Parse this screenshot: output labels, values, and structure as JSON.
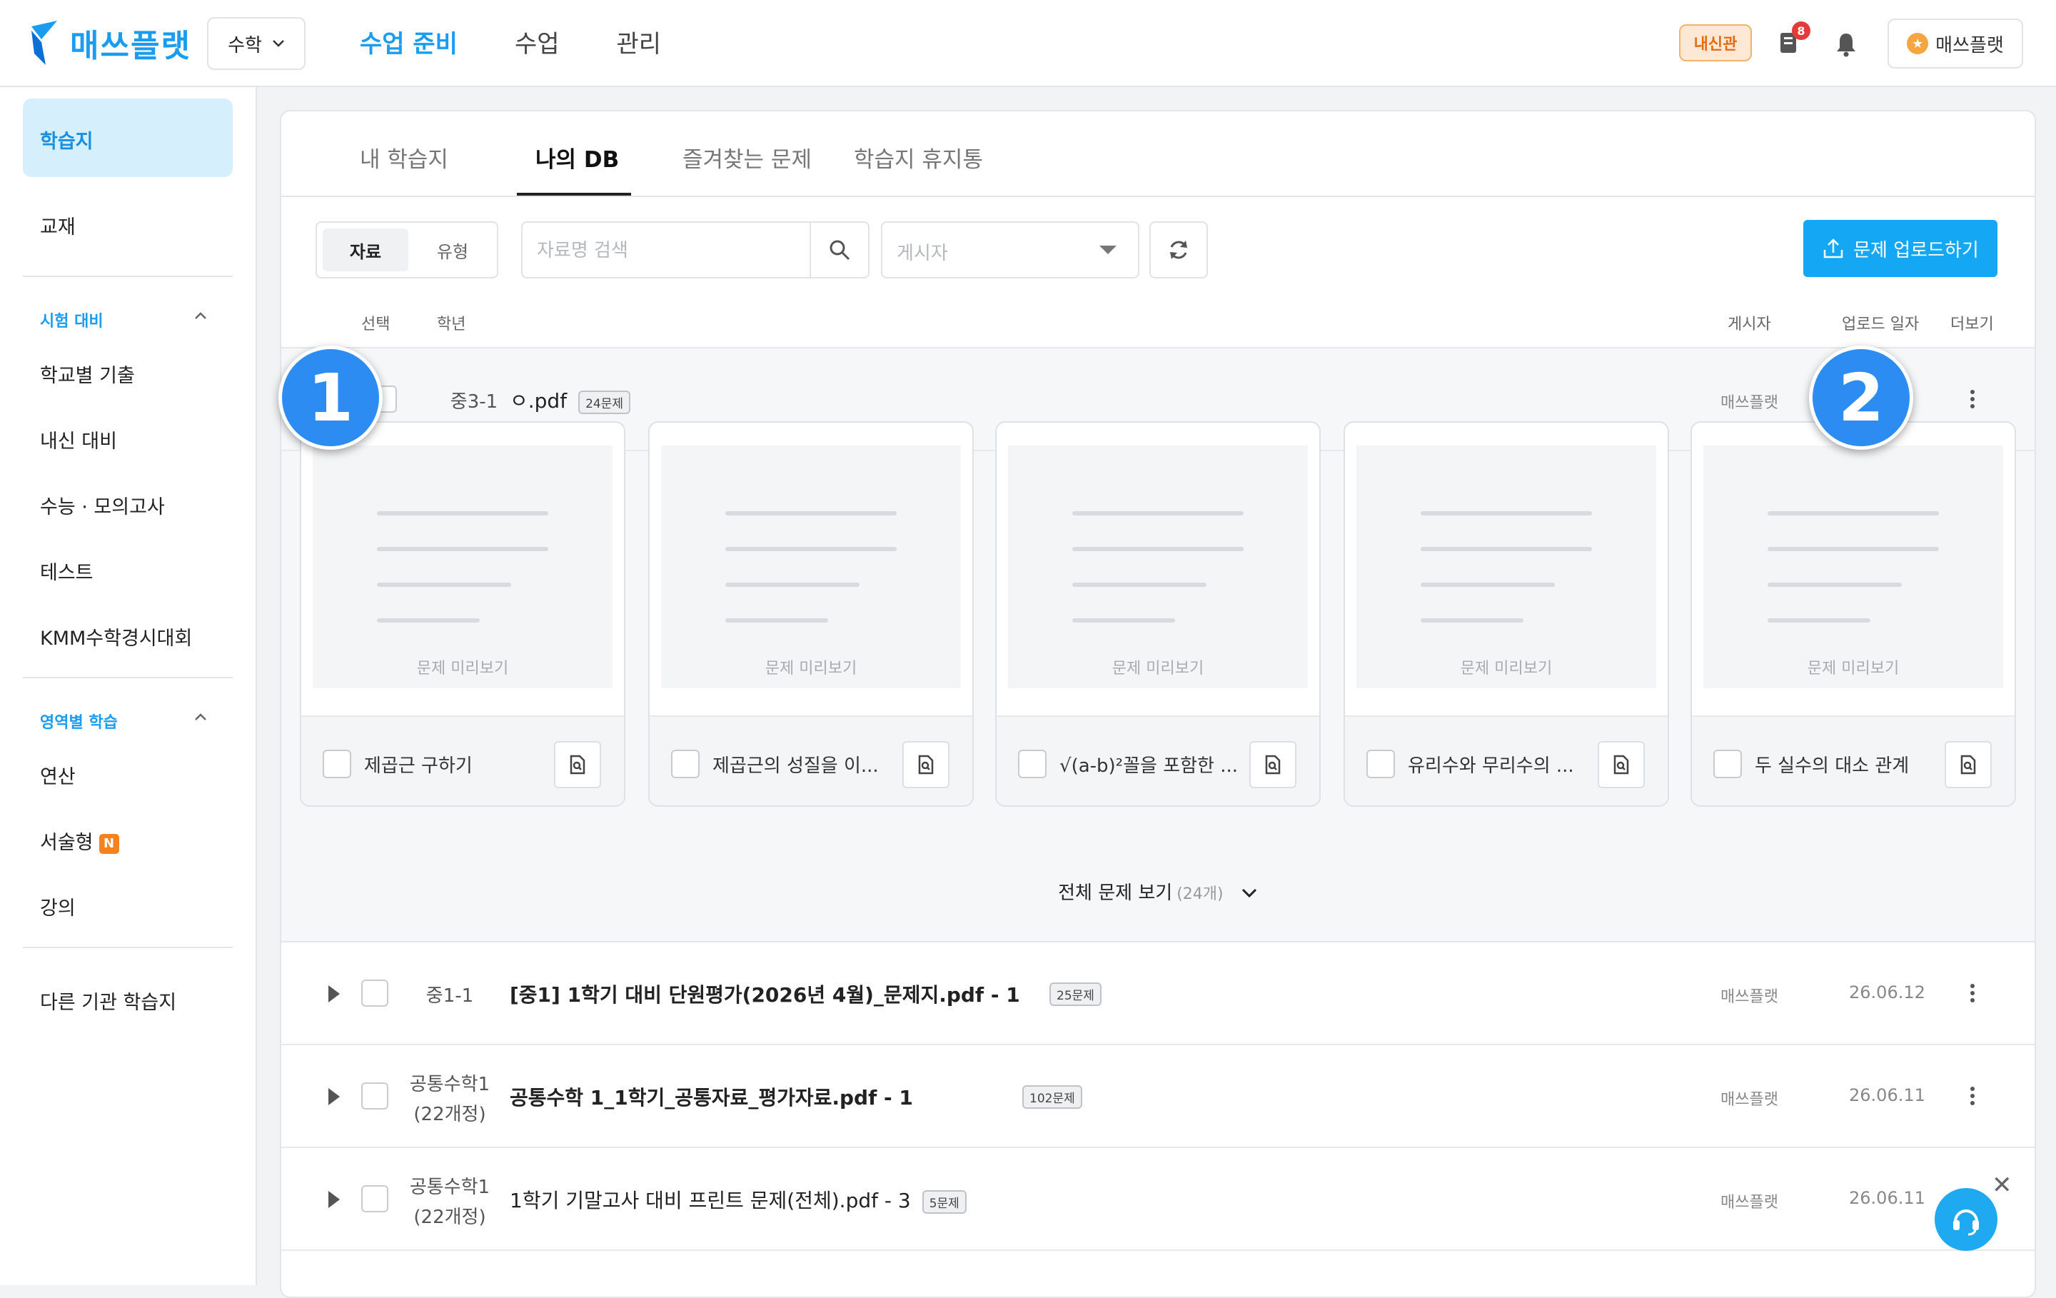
{
  "topbar": {
    "logo_text": "매쓰플랫",
    "subject": "수학",
    "nav": [
      "수업 준비",
      "수업",
      "관리"
    ],
    "naesin_badge": "내신관",
    "notification_count": "8",
    "profile_label": "매쓰플랫"
  },
  "sidebar": {
    "active": "학습지",
    "textbook": "교재",
    "section1": "시험 대비",
    "section1_items": [
      "학교별 기출",
      "내신 대비",
      "수능 · 모의고사",
      "테스트",
      "KMM수학경시대회"
    ],
    "section2": "영역별 학습",
    "section2_items": [
      "연산",
      "서술형",
      "강의"
    ],
    "new_badge": "N",
    "other": "다른 기관 학습지"
  },
  "tabs": [
    "내 학습지",
    "나의 DB",
    "즐겨찾는 문제",
    "학습지 휴지통"
  ],
  "toolbar": {
    "seg_on": "자료",
    "seg_off": "유형",
    "search_placeholder": "자료명 검색",
    "poster_placeholder": "게시자",
    "upload_label": "문제 업로드하기"
  },
  "columns": {
    "select": "선택",
    "grade": "학년",
    "poster": "게시자",
    "date": "업로드 일자",
    "more": "더보기"
  },
  "expanded_row": {
    "grade": "중3-1",
    "name": "ㅇ.pdf",
    "count": "24문제",
    "poster": "매쓰플랫",
    "cards": [
      {
        "preview": "문제 미리보기",
        "title": "제곱근 구하기"
      },
      {
        "preview": "문제 미리보기",
        "title": "제곱근의 성질을 이..."
      },
      {
        "preview": "문제 미리보기",
        "title": "√(a-b)²꼴을 포함한 ..."
      },
      {
        "preview": "문제 미리보기",
        "title": "유리수와 무리수의 ..."
      },
      {
        "preview": "문제 미리보기",
        "title": "두 실수의 대소 관계"
      }
    ],
    "view_all": "전체 문제 보기",
    "view_all_count": "(24개)"
  },
  "rows": [
    {
      "grade": "중1-1",
      "grade2": "",
      "name": "[중1] 1학기 대비 단원평가(2026년 4월)_문제지.pdf - 1",
      "count": "25문제",
      "poster": "매쓰플랫",
      "date": "26.06.12"
    },
    {
      "grade": "공통수학1",
      "grade2": "(22개정)",
      "name": "공통수학 1_1학기_공통자료_평가자료.pdf - 1",
      "count": "102문제",
      "poster": "매쓰플랫",
      "date": "26.06.11"
    },
    {
      "grade": "공통수학1",
      "grade2": "(22개정)",
      "name": "1학기 기말고사 대비 프린트 문제(전체).pdf - 3",
      "count": "5문제",
      "poster": "매쓰플랫",
      "date": "26.06.11"
    }
  ],
  "markers": [
    "1",
    "2"
  ],
  "colors": {
    "accent": "#1a9cf0",
    "upload": "#14a7f3",
    "marker": "#2c8cf2",
    "naesin": "#e66a10"
  }
}
